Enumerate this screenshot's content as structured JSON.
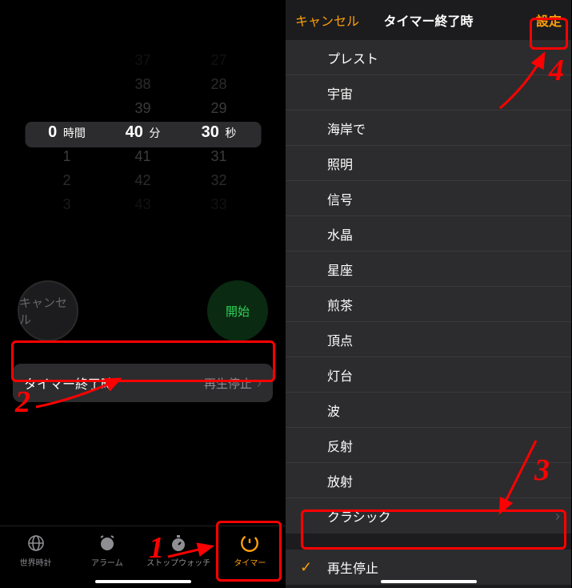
{
  "left": {
    "picker": {
      "hours": {
        "dim2": "",
        "dim1": "",
        "sel": "0",
        "unit": "時間",
        "next1": "1",
        "next2": "2",
        "next3": "3"
      },
      "minutes": {
        "dim2": "37",
        "dim1": "38",
        "near": "39",
        "sel": "40",
        "unit": "分",
        "next1": "41",
        "next2": "42",
        "next3": "43"
      },
      "seconds": {
        "dim2": "27",
        "dim1": "28",
        "near": "29",
        "sel": "30",
        "unit": "秒",
        "next1": "31",
        "next2": "32",
        "next3": "33"
      }
    },
    "cancel_label": "キャンセル",
    "start_label": "開始",
    "end_row": {
      "label": "タイマー終了時",
      "value": "再生停止"
    },
    "tabs": [
      {
        "label": "世界時計"
      },
      {
        "label": "アラーム"
      },
      {
        "label": "ストップウォッチ"
      },
      {
        "label": "タイマー"
      }
    ]
  },
  "right": {
    "header": {
      "cancel": "キャンセル",
      "title": "タイマー終了時",
      "set": "設定"
    },
    "sounds": [
      "プレスト",
      "宇宙",
      "海岸で",
      "照明",
      "信号",
      "水晶",
      "星座",
      "煎茶",
      "頂点",
      "灯台",
      "波",
      "反射",
      "放射",
      "クラシック"
    ],
    "stop_label": "再生停止"
  },
  "annotations": {
    "n1": "1",
    "n2": "2",
    "n3": "3",
    "n4": "4"
  }
}
